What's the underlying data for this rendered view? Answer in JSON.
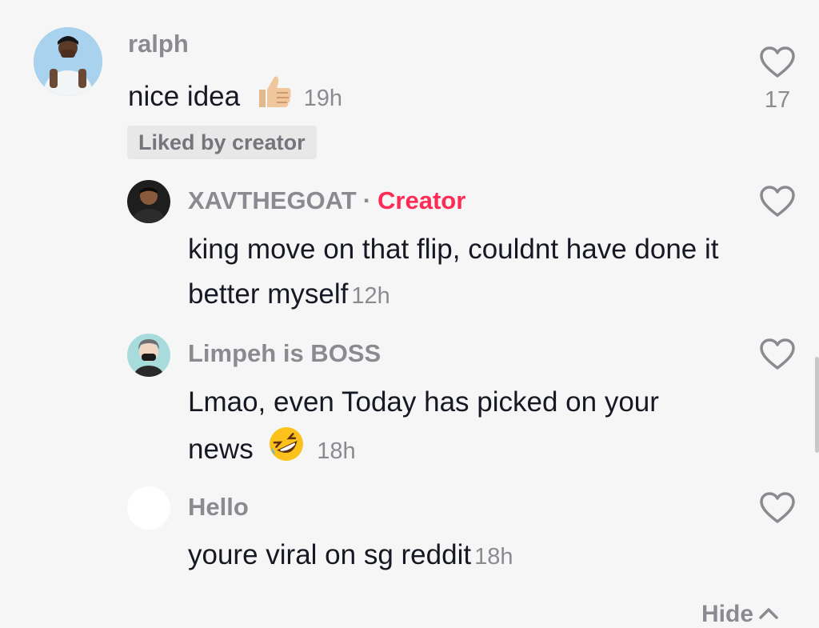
{
  "comments": [
    {
      "username": "ralph",
      "text": "nice idea",
      "emoji_icon": "thumbs-up-emoji",
      "time": "19h",
      "likes": "17",
      "badge": "Liked by creator"
    },
    {
      "username": "XAVTHEGOAT",
      "separator": "·",
      "creator_label": "Creator",
      "text": "king move on that flip, couldnt have done it better myself",
      "time": "12h"
    },
    {
      "username": "Limpeh is BOSS",
      "text": "Lmao, even Today has picked on your news",
      "emoji_icon": "rolling-on-floor-laughing-emoji",
      "time": "18h"
    },
    {
      "username": "Hello",
      "text": "youre viral on sg reddit",
      "time": "18h"
    }
  ],
  "hide_label": "Hide",
  "colors": {
    "background": "#f6f6f6",
    "creator_accent": "#fe2c55",
    "meta_gray": "#8a8b91",
    "text": "#161823"
  }
}
